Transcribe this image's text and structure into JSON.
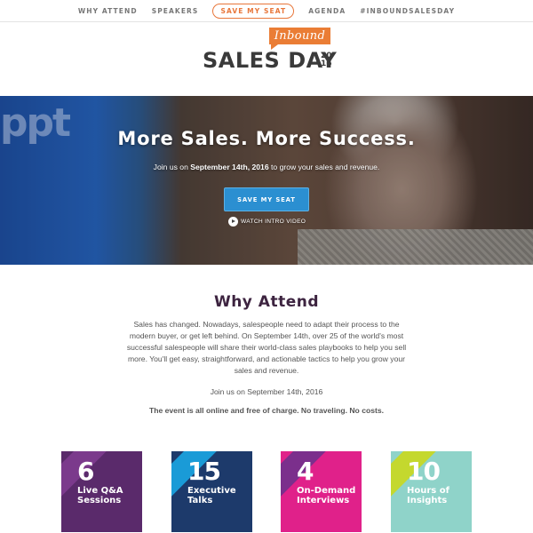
{
  "nav": {
    "items": [
      {
        "label": "WHY ATTEND"
      },
      {
        "label": "SPEAKERS"
      },
      {
        "label": "SAVE MY SEAT"
      },
      {
        "label": "AGENDA"
      },
      {
        "label": "#INBOUNDSALESDAY"
      }
    ]
  },
  "logo": {
    "tag": "Inbound",
    "main": "SALES DAY",
    "year_top": "20",
    "year_bottom": "16"
  },
  "hero": {
    "title": "More Sales. More Success.",
    "subtitle_pre": "Join us on ",
    "subtitle_date": "September 14th, 2016",
    "subtitle_post": " to grow your sales and revenue.",
    "button_label": "SAVE MY SEAT",
    "video_label": "WATCH INTRO VIDEO",
    "background_logo_text": "ppt"
  },
  "why": {
    "title": "Why Attend",
    "body": "Sales has changed. Nowadays, salespeople need to adapt their process to the modern buyer, or get left behind. On September 14th, over 25 of the world's most successful salespeople will share their world-class sales playbooks to help you sell more. You'll get easy, straightforward, and actionable tactics to help you grow your sales and revenue.",
    "date_line": "Join us on September 14th, 2016",
    "note": "The event is all online and free of charge. No traveling. No costs."
  },
  "stats": [
    {
      "number": "6",
      "label": "Live Q&A Sessions",
      "bg": "#5a2a6b",
      "stripe": "#7b3a8c"
    },
    {
      "number": "15",
      "label": "Executive Talks",
      "bg": "#1d3a6b",
      "stripe": "#1a9bd7"
    },
    {
      "number": "4",
      "label": "On-Demand Interviews",
      "bg": "#e0218a",
      "stripe": "#7b2f8c"
    },
    {
      "number": "10",
      "label": "Hours of Insights",
      "bg": "#8fd3c9",
      "stripe": "#c4d82e"
    }
  ],
  "colors": {
    "accent_orange": "#ea7d35",
    "button_blue": "#2b8fd1",
    "heading_purple": "#3d2440"
  }
}
